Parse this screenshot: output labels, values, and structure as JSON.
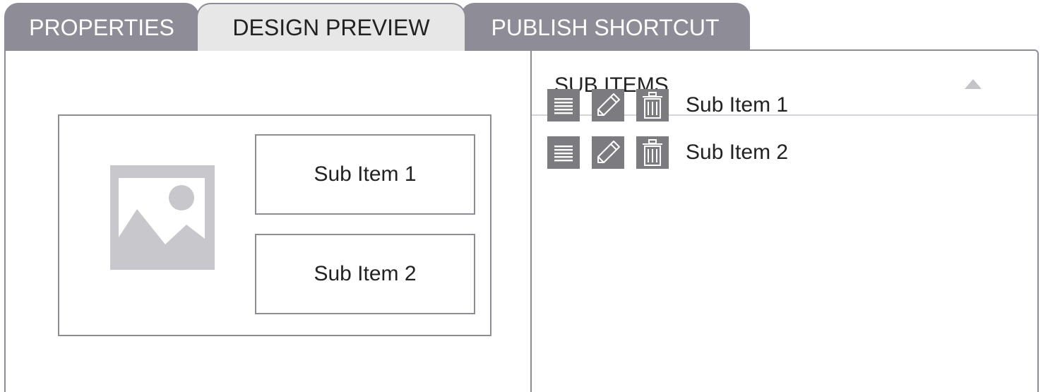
{
  "tabs": [
    {
      "label": "PROPERTIES",
      "active": false
    },
    {
      "label": "DESIGN PREVIEW",
      "active": true
    },
    {
      "label": "PUBLISH SHORTCUT",
      "active": false
    }
  ],
  "preview": {
    "image_icon": "image-placeholder-icon",
    "items": [
      "Sub Item 1",
      "Sub Item 2"
    ]
  },
  "sub_items_panel": {
    "title": "SUB ITEMS",
    "collapse_icon": "triangle-up-icon",
    "rows": [
      {
        "label": "Sub Item 1",
        "icons": [
          "drag-handle-icon",
          "pencil-icon",
          "trash-icon"
        ]
      },
      {
        "label": "Sub Item 2",
        "icons": [
          "drag-handle-icon",
          "pencil-icon",
          "trash-icon"
        ]
      }
    ]
  },
  "colors": {
    "tab_inactive": "#8e8c96",
    "tab_active": "#e7e7e7",
    "border": "#8e8c96",
    "icon_bg": "#7c7b80",
    "placeholder": "#c8c8cc"
  }
}
